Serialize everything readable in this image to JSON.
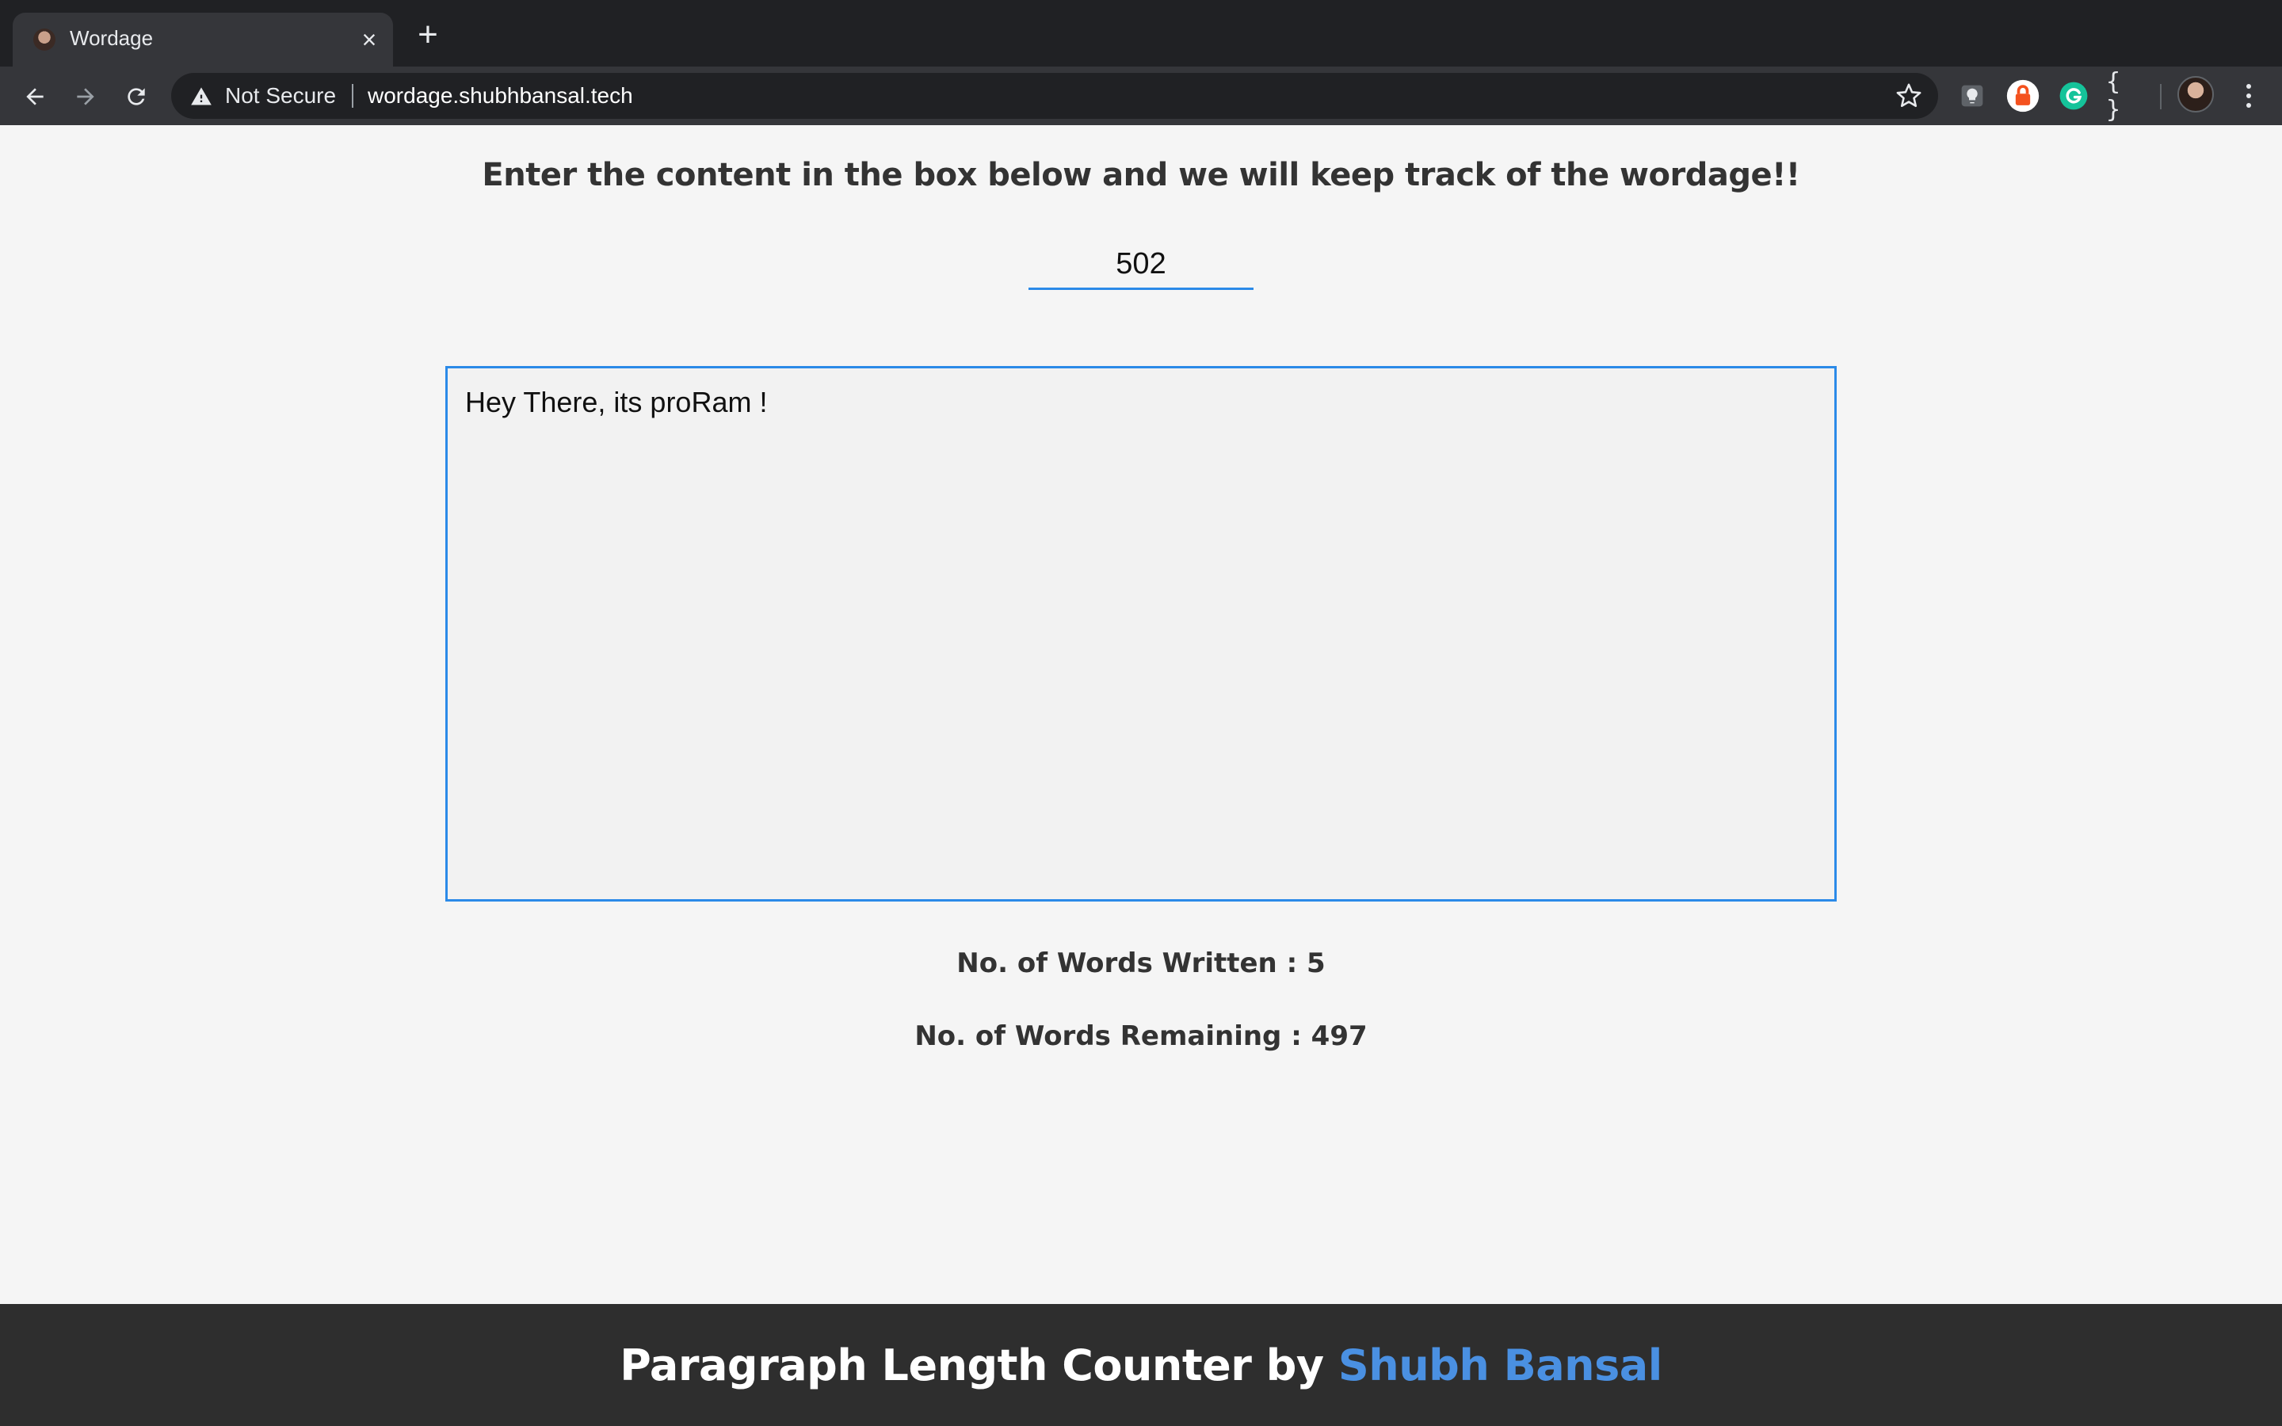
{
  "browser": {
    "tab": {
      "title": "Wordage",
      "close_glyph": "×",
      "favicon": "avatar-favicon"
    },
    "new_tab_glyph": "+",
    "omnibox": {
      "security_label": "Not Secure",
      "url": "wordage.shubhbansal.tech"
    },
    "extensions": [
      "bulb-extension-icon",
      "lock-extension-icon",
      "grammarly-icon",
      "braces-extension-icon"
    ],
    "braces_glyph": "{ }",
    "colors": {
      "tabstrip": "#202124",
      "toolbar": "#35363a",
      "omnibox": "#202124",
      "lock_extension": "#f4511e",
      "grammarly": "#15c39a"
    }
  },
  "page": {
    "heading": "Enter the content in the box below and we will keep track of the wordage!!",
    "word_limit": "502",
    "content": "Hey There, its proRam !",
    "stats": {
      "written": "No. of Words Written : 5",
      "remaining": "No. of Words Remaining : 497"
    },
    "colors": {
      "background": "#f5f5f5",
      "accent": "#2b8ae8",
      "text": "#333333"
    }
  },
  "footer": {
    "text": "Paragraph Length Counter by ",
    "author_link": "Shubh Bansal",
    "colors": {
      "background": "#2e2e2e",
      "link": "#4a90e2"
    }
  }
}
